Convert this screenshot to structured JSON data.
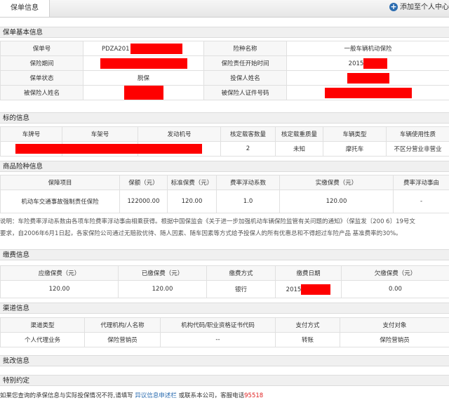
{
  "tab": {
    "title": "保单信息"
  },
  "add_link": {
    "label": "添加至个人中心"
  },
  "basic": {
    "title": "保单基本信息",
    "rows": [
      {
        "l1": "保单号",
        "v1": "PDZA201",
        "l2": "险种名称",
        "v2": "一般车辆机动保险"
      },
      {
        "l1": "保险期间",
        "v1": "",
        "l2": "保险责任开始时间",
        "v2": "2015"
      },
      {
        "l1": "保单状态",
        "v1": "脱保",
        "l2": "投保人姓名",
        "v2": ""
      },
      {
        "l1": "被保险人姓名",
        "v1": "",
        "l2": "被保险人证件号码",
        "v2": ""
      }
    ]
  },
  "target": {
    "title": "标的信息",
    "headers": [
      "车牌号",
      "车架号",
      "发动机号",
      "核定载客数量",
      "核定载重质量",
      "车辆类型",
      "车辆使用性质"
    ],
    "row": [
      "",
      "",
      "",
      "2",
      "未知",
      "摩托车",
      "不区分营业非营业"
    ]
  },
  "product": {
    "title": "商品险种信息",
    "headers": [
      "保障项目",
      "保额（元）",
      "标准保费（元）",
      "费率浮动系数",
      "实缴保费（元）",
      "费率浮动事由"
    ],
    "row": [
      "机动车交通事故强制责任保险",
      "122000.00",
      "120.00",
      "1.0",
      "120.00",
      "-"
    ]
  },
  "note": {
    "line1": "说明：车险费率浮动系数由各项车险费率浮动事由相乘获得。根据中国保监会《关于进一步加强机动车辆保险监管有关问题的通知》（保监发〔200 6〕19号文",
    "line2": "要求，自2006年6月1日起，各家保险公司通过无赔款优待、随人因素、随车因素等方式给予投保人的所有优惠总和不得超过车险产品 基准费率的30%。"
  },
  "payment": {
    "title": "缴费信息",
    "headers": [
      "应缴保费（元）",
      "已缴保费（元）",
      "缴费方式",
      "缴费日期",
      "欠缴保费（元）"
    ],
    "row": [
      "120.00",
      "120.00",
      "银行",
      "2015",
      "0.00"
    ]
  },
  "channel": {
    "title": "渠道信息",
    "headers": [
      "渠道类型",
      "代理机构/人名称",
      "机构代码/职业资格证书代码",
      "支付方式",
      "支付对象"
    ],
    "row": [
      "个人代理业务",
      "保险营销员",
      "--",
      "转账",
      "保险营销员"
    ]
  },
  "endorse": {
    "title": "批改信息"
  },
  "special": {
    "title": "特别约定"
  },
  "footer": {
    "text": "如果您查询的承保信息与实际投保情况不符,请填写 ",
    "link": "异议信息申述栏",
    "mid": " 或联系本公司，客服电话",
    "phone": "95518"
  },
  "colors": {
    "redaction": "#fe0000",
    "link": "#2b6cb0",
    "phone": "#e02020"
  }
}
